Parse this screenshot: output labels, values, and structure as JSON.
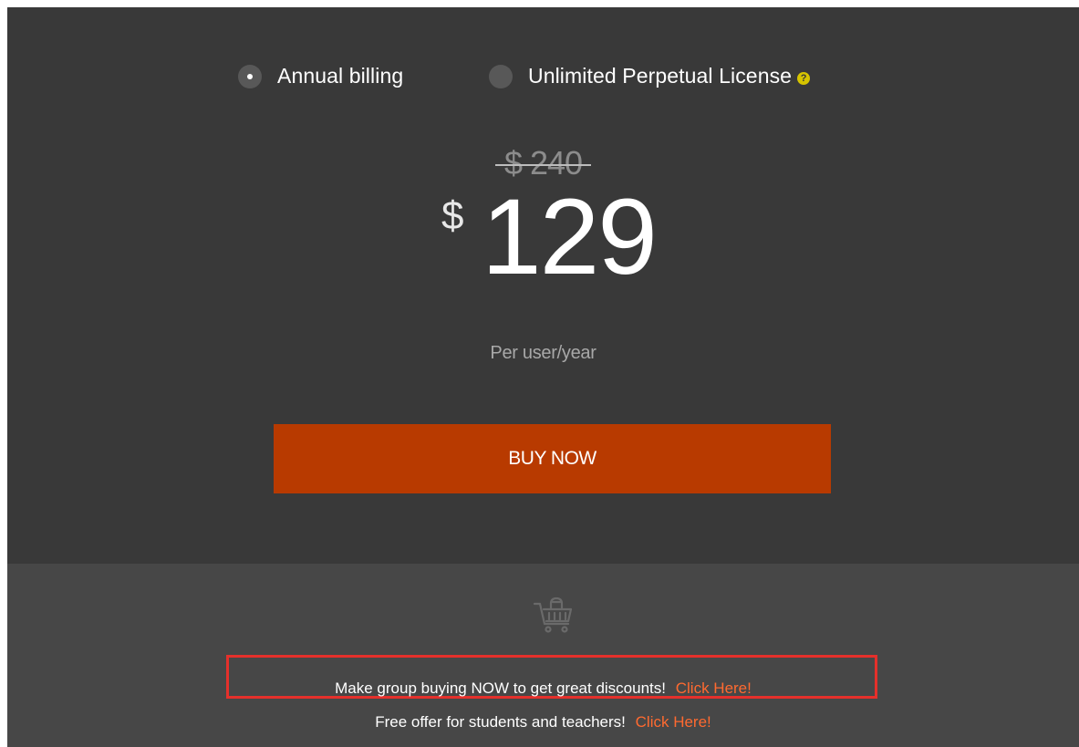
{
  "billing": {
    "options": [
      {
        "label": "Annual billing",
        "selected": true
      },
      {
        "label": "Unlimited Perpetual License",
        "selected": false,
        "help_icon": "help-icon"
      }
    ]
  },
  "pricing": {
    "original_price": "$ 240",
    "currency": "$",
    "amount": "129",
    "period": "Per user/year",
    "buy_label": "BUY NOW"
  },
  "promotions": {
    "cart_icon": "shopping-cart-icon",
    "group_text": "Make group buying NOW to get great discounts!",
    "group_link": "Click Here!",
    "student_text": "Free offer for students and teachers!",
    "student_link": "Click Here!"
  },
  "colors": {
    "panel_bg": "#393939",
    "footer_bg": "#474747",
    "buy_button": "#b83a00",
    "link": "#ff6a30",
    "highlight_border": "#e5302b",
    "help_icon": "#d6c400"
  }
}
